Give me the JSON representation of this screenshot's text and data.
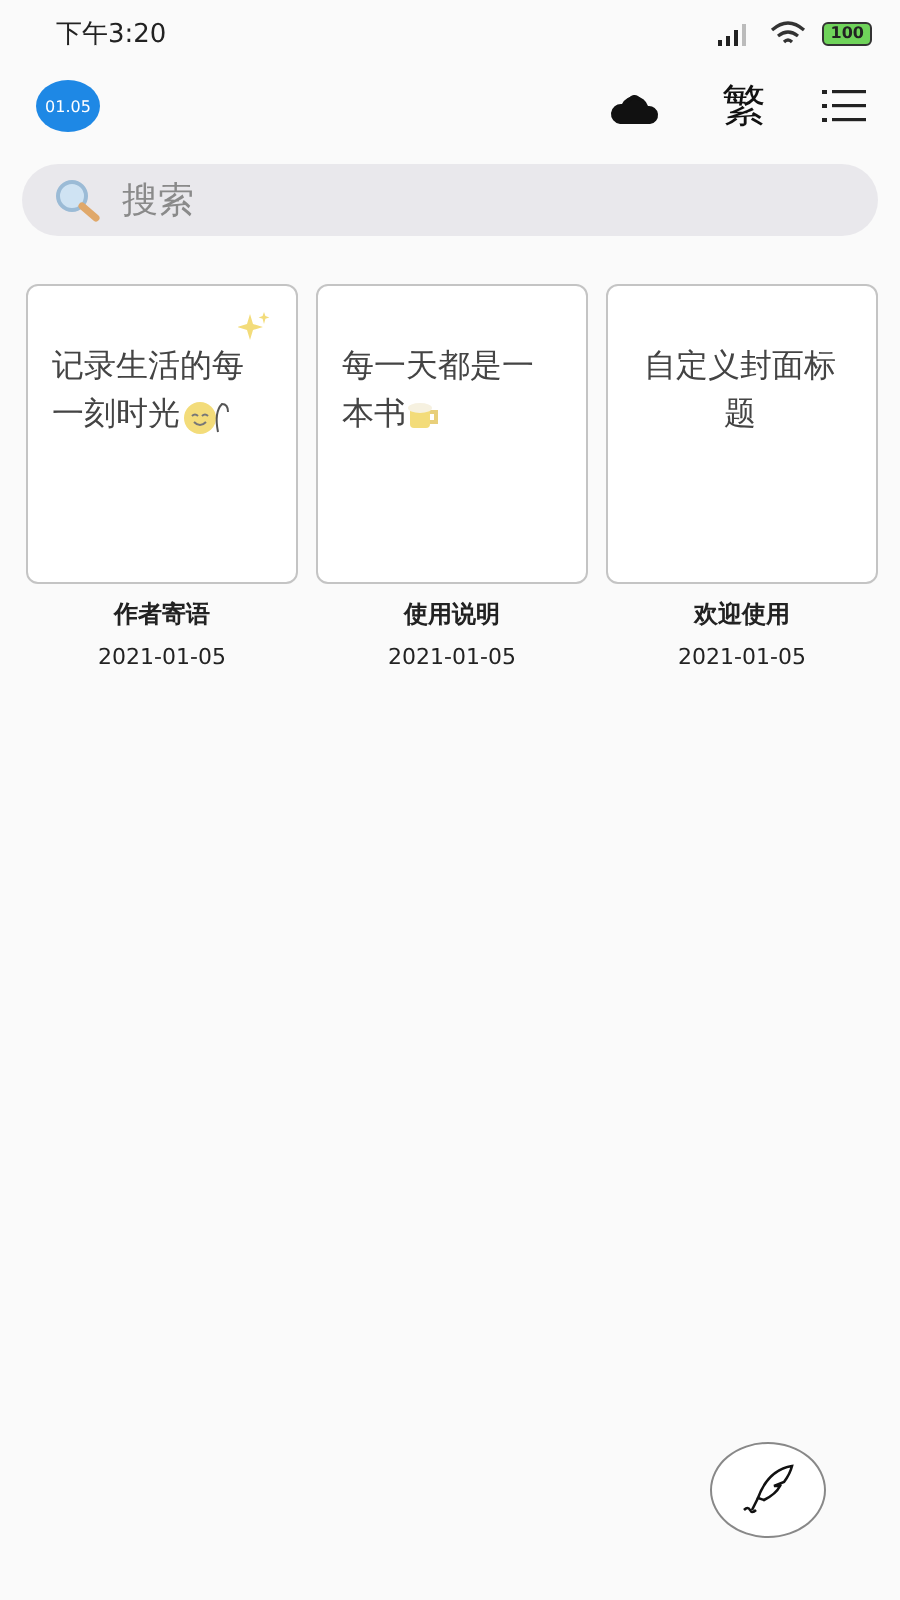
{
  "status_bar": {
    "time": "下午3:20",
    "battery": "100"
  },
  "header": {
    "date_badge": "01.05",
    "script_toggle": "繁"
  },
  "search": {
    "placeholder": "搜索"
  },
  "books": [
    {
      "cover_text": "记录生活的每一刻时光",
      "kind": "smile",
      "title": "作者寄语",
      "date": "2021-01-05"
    },
    {
      "cover_text": "每一天都是一本书",
      "kind": "mug",
      "title": "使用说明",
      "date": "2021-01-05"
    },
    {
      "cover_text": "自定义封面标题",
      "kind": "plain",
      "title": "欢迎使用",
      "date": "2021-01-05"
    }
  ]
}
